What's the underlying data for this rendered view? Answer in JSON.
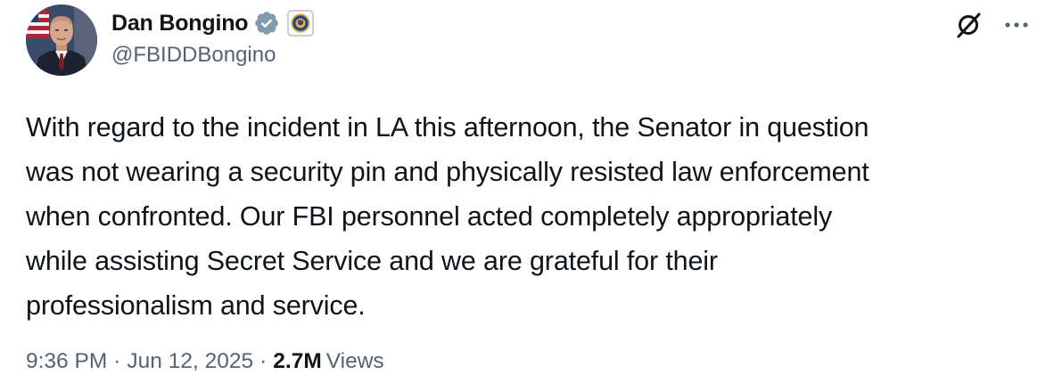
{
  "author": {
    "display_name": "Dan Bongino",
    "handle": "@FBIDDBongino",
    "verified": true,
    "badge_color": "#829aab",
    "affiliate": "FBI"
  },
  "tweet": {
    "text": "With regard to the incident in LA this afternoon, the Senator in question\nwas not wearing a security pin and physically resisted law enforcement\nwhen confronted. Our FBI personnel acted completely appropriately\nwhile assisting Secret Service and we are grateful for their\nprofessionalism and service.",
    "time": "9:36 PM",
    "date": "Jun 12, 2025",
    "views_count": "2.7M",
    "views_label": "Views",
    "separator": "·"
  },
  "icons": {
    "grok": "grok-icon",
    "more": "more-icon",
    "verified": "verified-badge-icon",
    "affiliate": "fbi-seal-icon"
  },
  "colors": {
    "text_primary": "#0f1419",
    "text_secondary": "#536471"
  }
}
